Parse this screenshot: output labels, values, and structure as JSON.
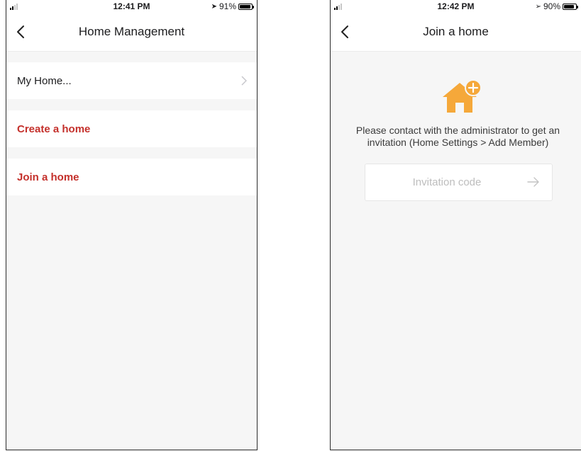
{
  "left_screen": {
    "status": {
      "time": "12:41 PM",
      "battery": "91%",
      "battery_level": 0.91
    },
    "nav": {
      "title": "Home Management"
    },
    "rows": [
      {
        "label": "My Home..."
      },
      {
        "label": "Create a home"
      },
      {
        "label": "Join a home"
      }
    ]
  },
  "right_screen": {
    "status": {
      "time": "12:42 PM",
      "battery": "90%",
      "battery_level": 0.9
    },
    "nav": {
      "title": "Join a home"
    },
    "instruction": "Please contact with the administrator to get an invitation (Home Settings > Add Member)",
    "invitation": {
      "placeholder": "Invitation code",
      "value": ""
    }
  },
  "colors": {
    "accent_red": "#c4302b",
    "icon_orange": "#f5a83a",
    "background": "#f6f6f6"
  },
  "icons": {
    "back": "chevron-left-icon",
    "row_arrow": "chevron-right-icon",
    "home": "house-plus-icon",
    "submit": "arrow-right-icon"
  }
}
